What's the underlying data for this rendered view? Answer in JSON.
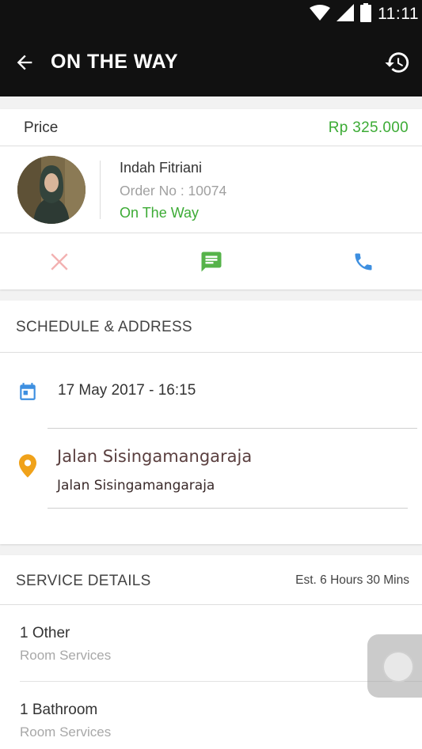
{
  "status_bar": {
    "time": "11:11",
    "icons": [
      "wifi-icon",
      "signal-icon",
      "battery-icon"
    ]
  },
  "app_bar": {
    "title": "ON THE WAY",
    "back_icon": "arrow-back-icon",
    "history_icon": "history-icon"
  },
  "order": {
    "price_label": "Price",
    "price_value": "Rp 325.000",
    "name": "Indah Fitriani",
    "order_no": "Order No : 10074",
    "status": "On The Way",
    "actions": [
      "cancel-icon",
      "message-icon",
      "phone-icon"
    ]
  },
  "schedule": {
    "title": "SCHEDULE & ADDRESS",
    "datetime": "17 May 2017 - 16:15",
    "address_title": "Jalan Sisingamangaraja",
    "address_detail": "Jalan Sisingamangaraja"
  },
  "service": {
    "title": "SERVICE DETAILS",
    "estimate": "Est. 6 Hours 30 Mins",
    "items": [
      {
        "name": "1 Other",
        "category": "Room Services"
      },
      {
        "name": "1 Bathroom",
        "category": "Room Services"
      }
    ]
  },
  "colors": {
    "bar": "#111111",
    "green": "#3cab35",
    "blue": "#3d8fe0",
    "cancel": "#f3b1b1",
    "pin": "#f0a21a"
  }
}
